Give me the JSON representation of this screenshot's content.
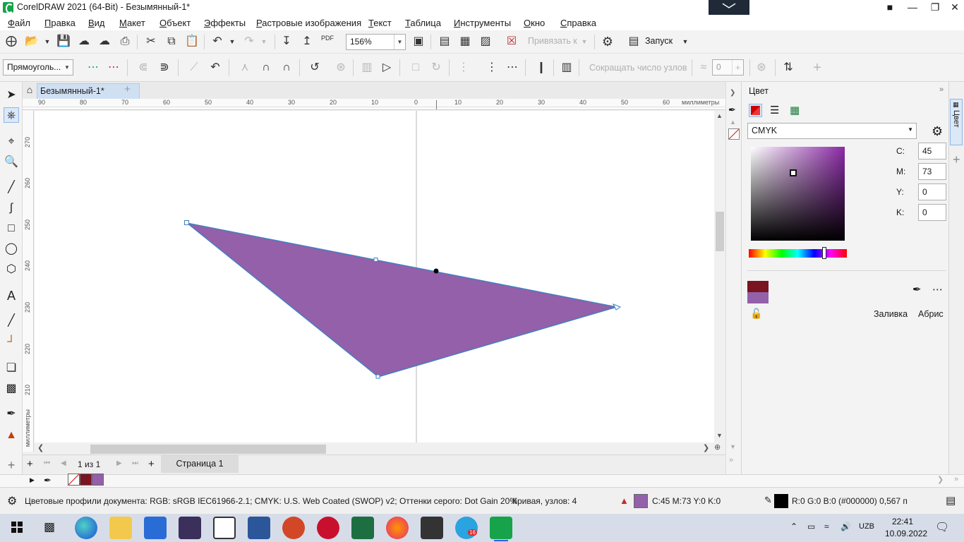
{
  "window": {
    "title": "CorelDRAW 2021 (64-Bit) - Безымянный-1*",
    "touch_toggle_glyph": "﹀",
    "min_glyph": "—",
    "restore_glyph": "❐",
    "close_glyph": "✕"
  },
  "menu": [
    "Файл",
    "Правка",
    "Вид",
    "Макет",
    "Объект",
    "Эффекты",
    "Растровые изображения",
    "Текст",
    "Таблица",
    "Инструменты",
    "Окно",
    "Справка"
  ],
  "toolbar": {
    "zoom_value": "156%",
    "snap_to_label": "Привязать к",
    "launch_label": "Запуск",
    "pdf_label": "PDF"
  },
  "property_bar": {
    "object_type": "Прямоуголь...",
    "reduce_nodes_label": "Сокращать число узлов",
    "smoothness_value": "0"
  },
  "document": {
    "tab_title": "Безымянный-1*"
  },
  "ruler": {
    "h_ticks": [
      "90",
      "80",
      "70",
      "60",
      "50",
      "40",
      "30",
      "20",
      "10",
      "0",
      "10",
      "20",
      "30",
      "40",
      "50",
      "60"
    ],
    "unit_label": "миллиметры",
    "v_ticks": [
      "270",
      "260",
      "250",
      "240",
      "230",
      "220",
      "210"
    ],
    "v_unit_label": "миллиметры"
  },
  "page_nav": {
    "current": "1",
    "of_label": "из",
    "total": "1",
    "page_tab": "Страница 1"
  },
  "docker": {
    "title": "Цвет",
    "model": "CMYK",
    "c_label": "C:",
    "c_value": "45",
    "m_label": "M:",
    "m_value": "73",
    "y_label": "Y:",
    "y_value": "0",
    "k_label": "K:",
    "k_value": "0",
    "fill_label": "Заливка",
    "outline_label": "Абрис",
    "side_tab": "Цвет"
  },
  "colors": {
    "shape_fill": "#9360a9",
    "shape_outline": "#3b82c4",
    "current_color": "#8b2aa6",
    "dark_red": "#7a1420",
    "purple_swatch": "#9360a9"
  },
  "status": {
    "color_profiles": "Цветовые профили документа: RGB: sRGB IEC61966-2.1; CMYK: U.S. Web Coated (SWOP) v2; Оттенки серого: Dot Gain 20%",
    "object_info": "Кривая, узлов: 4",
    "fill_info": "C:45 M:73 Y:0 K:0",
    "outline_info": "R:0 G:0 B:0 (#000000)  0,567 п"
  },
  "taskbar": {
    "language": "UZB",
    "time": "22:41",
    "date": "10.09.2022",
    "telegram_badge": "16"
  }
}
